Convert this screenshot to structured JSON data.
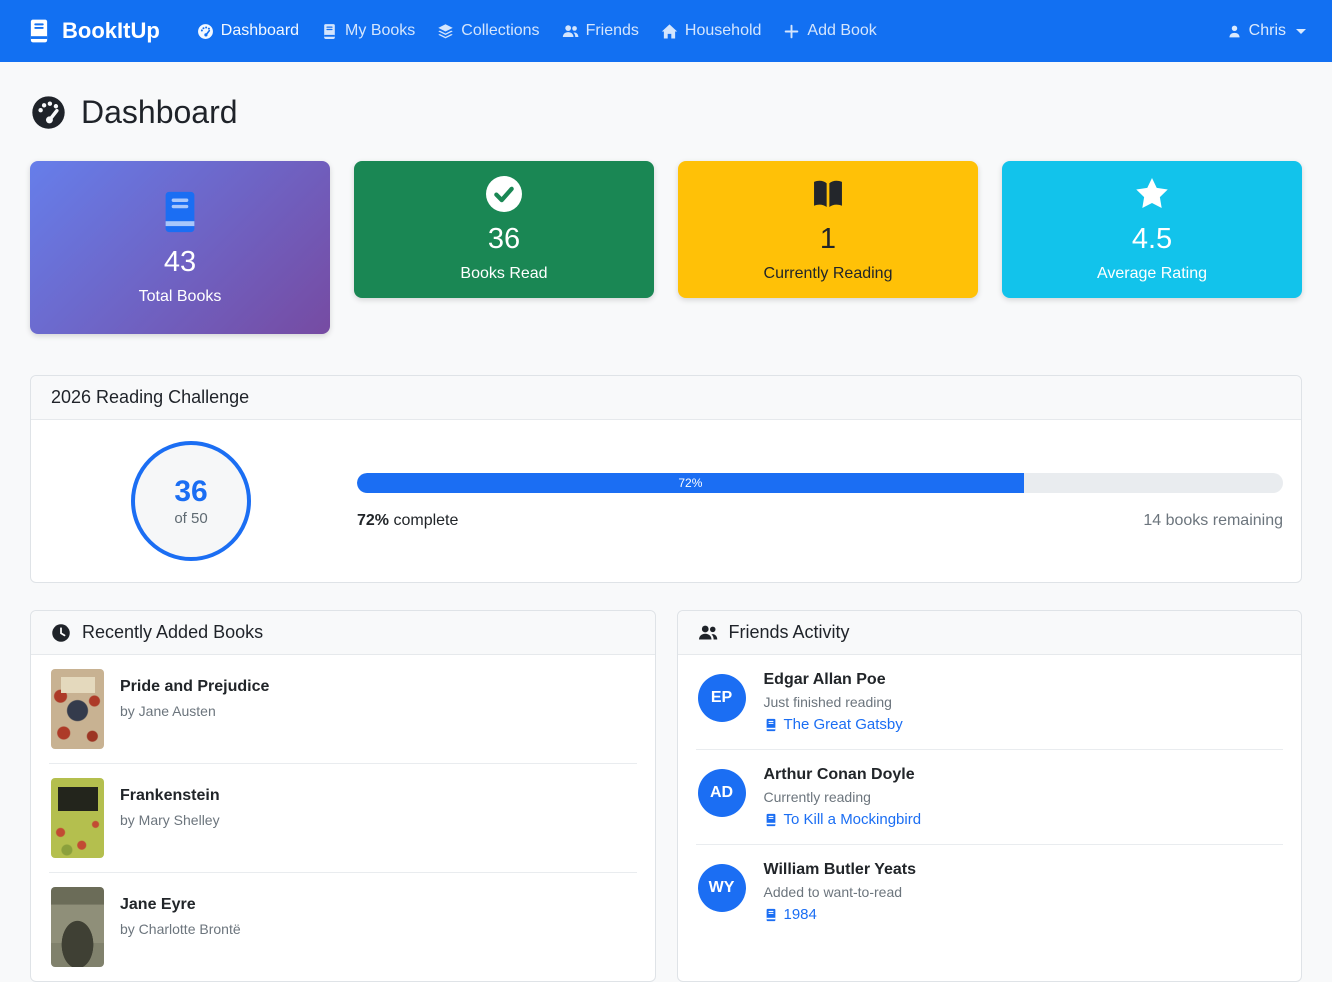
{
  "navbar": {
    "brand": "BookItUp",
    "items": [
      {
        "label": "Dashboard",
        "icon": "gauge-icon"
      },
      {
        "label": "My Books",
        "icon": "book-icon"
      },
      {
        "label": "Collections",
        "icon": "stack-icon"
      },
      {
        "label": "Friends",
        "icon": "people-icon"
      },
      {
        "label": "Household",
        "icon": "house-icon"
      },
      {
        "label": "Add Book",
        "icon": "plus-icon"
      }
    ],
    "user": "Chris"
  },
  "page_title": "Dashboard",
  "stats": [
    {
      "value": "43",
      "label": "Total Books",
      "icon": "book-icon"
    },
    {
      "value": "36",
      "label": "Books Read",
      "icon": "check-circle-icon"
    },
    {
      "value": "1",
      "label": "Currently Reading",
      "icon": "open-book-icon"
    },
    {
      "value": "4.5",
      "label": "Average Rating",
      "icon": "star-icon"
    }
  ],
  "challenge": {
    "title": "2026 Reading Challenge",
    "count": "36",
    "goal": "of 50",
    "percent": 72,
    "bar_label": "72%",
    "complete_strong": "72%",
    "complete_text": " complete",
    "remaining": "14 books remaining"
  },
  "recent_books": {
    "title": "Recently Added Books",
    "items": [
      {
        "title": "Pride and Prejudice",
        "author": "by Jane Austen"
      },
      {
        "title": "Frankenstein",
        "author": "by Mary Shelley"
      },
      {
        "title": "Jane Eyre",
        "author": "by Charlotte Brontë"
      }
    ]
  },
  "friends_activity": {
    "title": "Friends Activity",
    "items": [
      {
        "initials": "EP",
        "name": "Edgar Allan Poe",
        "action": "Just finished reading",
        "book": "The Great Gatsby"
      },
      {
        "initials": "AD",
        "name": "Arthur Conan Doyle",
        "action": "Currently reading",
        "book": "To Kill a Mockingbird"
      },
      {
        "initials": "WY",
        "name": "William Butler Yeats",
        "action": "Added to want-to-read",
        "book": "1984"
      }
    ]
  },
  "colors": {
    "navbar": "#1270f2",
    "primary": "#1b6ef3",
    "success": "#1a8754",
    "warning": "#ffc107",
    "info": "#12c3eb",
    "purple_gradient_start": "#667eea",
    "purple_gradient_end": "#764ba2"
  }
}
